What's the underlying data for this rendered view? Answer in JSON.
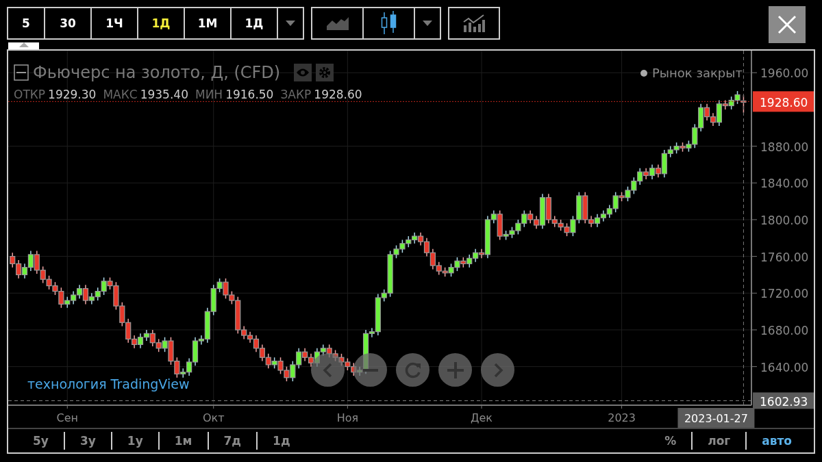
{
  "toolbar": {
    "intervals": [
      {
        "label": "5",
        "selected": false
      },
      {
        "label": "30",
        "selected": false
      },
      {
        "label": "1Ч",
        "selected": false
      },
      {
        "label": "1Д",
        "selected": true
      },
      {
        "label": "1М",
        "selected": false
      },
      {
        "label": "1Д",
        "selected": false
      }
    ],
    "chart_types": [
      {
        "kind": "line",
        "selected": false
      },
      {
        "kind": "candles",
        "selected": true
      }
    ]
  },
  "legend": {
    "title": "Фьючерс на золото, Д, (CFD)",
    "values": [
      {
        "label": "ОТКР",
        "value": "1929.30"
      },
      {
        "label": "МАКС",
        "value": "1935.40"
      },
      {
        "label": "МИН",
        "value": "1916.50"
      },
      {
        "label": "ЗАКР",
        "value": "1928.60"
      }
    ],
    "status": "Рынок закрыт"
  },
  "chart": {
    "last_price": "1928.60",
    "low_level": "1602.93",
    "crosshair_date": "2023-01-27",
    "attribution": "технология TradingView",
    "chart_data": {
      "type": "candlestick",
      "grid": true,
      "ylim": [
        1598,
        1984
      ],
      "yticks": [
        {
          "value": 1640,
          "label": "1640.00"
        },
        {
          "value": 1680,
          "label": "1680.00"
        },
        {
          "value": 1720,
          "label": "1720.00"
        },
        {
          "value": 1760,
          "label": "1760.00"
        },
        {
          "value": 1800,
          "label": "1800.00"
        },
        {
          "value": 1840,
          "label": "1840.00"
        },
        {
          "value": 1880,
          "label": "1880.00"
        },
        {
          "value": 1960,
          "label": "1960.00"
        }
      ],
      "ref_lines": [
        {
          "axis": "y",
          "value": 1928.6,
          "color": "#c0261c"
        },
        {
          "axis": "y",
          "value": 1602.93,
          "color": "#888888"
        }
      ],
      "categories": [
        null,
        null,
        null,
        null,
        null,
        null,
        null,
        null,
        null,
        "Сен",
        null,
        null,
        null,
        null,
        null,
        null,
        null,
        null,
        null,
        null,
        null,
        null,
        null,
        null,
        null,
        null,
        null,
        null,
        null,
        null,
        null,
        null,
        null,
        "Окт",
        null,
        null,
        null,
        null,
        null,
        null,
        null,
        null,
        null,
        null,
        null,
        null,
        null,
        null,
        null,
        null,
        null,
        null,
        null,
        null,
        null,
        "Ноя",
        null,
        null,
        null,
        null,
        null,
        null,
        null,
        null,
        null,
        null,
        null,
        null,
        null,
        null,
        null,
        null,
        null,
        null,
        null,
        null,
        null,
        "Дек",
        null,
        null,
        null,
        null,
        null,
        null,
        null,
        null,
        null,
        null,
        null,
        null,
        null,
        null,
        null,
        null,
        null,
        null,
        null,
        null,
        null,
        null,
        "2023",
        null,
        null,
        null,
        null,
        null,
        null,
        null,
        null,
        null,
        null,
        null,
        null,
        null,
        null,
        null,
        null,
        null,
        null,
        null,
        null
      ],
      "ohlc": [
        [
          1760,
          1764,
          1748,
          1752
        ],
        [
          1752,
          1756,
          1736,
          1740
        ],
        [
          1740,
          1752,
          1736,
          1748
        ],
        [
          1748,
          1766,
          1744,
          1762
        ],
        [
          1762,
          1766,
          1741,
          1745
        ],
        [
          1745,
          1749,
          1731,
          1735
        ],
        [
          1735,
          1739,
          1724,
          1728
        ],
        [
          1728,
          1732,
          1718,
          1722
        ],
        [
          1722,
          1726,
          1704,
          1708
        ],
        [
          1708,
          1716,
          1704,
          1712
        ],
        [
          1712,
          1722,
          1708,
          1718
        ],
        [
          1718,
          1729,
          1714,
          1725
        ],
        [
          1725,
          1729,
          1708,
          1712
        ],
        [
          1712,
          1720,
          1708,
          1716
        ],
        [
          1716,
          1726,
          1712,
          1722
        ],
        [
          1722,
          1737,
          1718,
          1733
        ],
        [
          1733,
          1737,
          1724,
          1728
        ],
        [
          1728,
          1732,
          1702,
          1706
        ],
        [
          1706,
          1710,
          1684,
          1688
        ],
        [
          1688,
          1692,
          1666,
          1670
        ],
        [
          1670,
          1674,
          1660,
          1664
        ],
        [
          1664,
          1676,
          1660,
          1672
        ],
        [
          1672,
          1680,
          1668,
          1676
        ],
        [
          1676,
          1680,
          1662,
          1666
        ],
        [
          1666,
          1670,
          1656,
          1660
        ],
        [
          1660,
          1672,
          1656,
          1668
        ],
        [
          1668,
          1672,
          1642,
          1646
        ],
        [
          1646,
          1650,
          1628,
          1632
        ],
        [
          1632,
          1638,
          1628,
          1634
        ],
        [
          1634,
          1649,
          1630,
          1645
        ],
        [
          1645,
          1672,
          1641,
          1668
        ],
        [
          1668,
          1674,
          1664,
          1670
        ],
        [
          1670,
          1704,
          1666,
          1700
        ],
        [
          1700,
          1729,
          1696,
          1725
        ],
        [
          1725,
          1736,
          1721,
          1732
        ],
        [
          1732,
          1736,
          1714,
          1718
        ],
        [
          1718,
          1722,
          1708,
          1712
        ],
        [
          1712,
          1716,
          1676,
          1680
        ],
        [
          1680,
          1684,
          1670,
          1674
        ],
        [
          1674,
          1678,
          1666,
          1670
        ],
        [
          1670,
          1674,
          1656,
          1660
        ],
        [
          1660,
          1664,
          1646,
          1650
        ],
        [
          1650,
          1654,
          1638,
          1642
        ],
        [
          1642,
          1650,
          1638,
          1646
        ],
        [
          1646,
          1650,
          1632,
          1636
        ],
        [
          1636,
          1640,
          1624,
          1628
        ],
        [
          1628,
          1646,
          1624,
          1642
        ],
        [
          1642,
          1660,
          1638,
          1656
        ],
        [
          1656,
          1660,
          1646,
          1650
        ],
        [
          1650,
          1654,
          1640,
          1644
        ],
        [
          1644,
          1660,
          1640,
          1656
        ],
        [
          1656,
          1664,
          1652,
          1660
        ],
        [
          1660,
          1664,
          1650,
          1654
        ],
        [
          1654,
          1658,
          1646,
          1650
        ],
        [
          1650,
          1654,
          1641,
          1645
        ],
        [
          1645,
          1649,
          1636,
          1640
        ],
        [
          1640,
          1644,
          1630,
          1634
        ],
        [
          1634,
          1640,
          1630,
          1636
        ],
        [
          1636,
          1680,
          1632,
          1676
        ],
        [
          1676,
          1682,
          1672,
          1678
        ],
        [
          1678,
          1719,
          1674,
          1715
        ],
        [
          1715,
          1724,
          1711,
          1720
        ],
        [
          1720,
          1766,
          1716,
          1762
        ],
        [
          1762,
          1772,
          1758,
          1768
        ],
        [
          1768,
          1778,
          1764,
          1774
        ],
        [
          1774,
          1782,
          1770,
          1778
        ],
        [
          1778,
          1786,
          1774,
          1782
        ],
        [
          1782,
          1786,
          1772,
          1776
        ],
        [
          1776,
          1780,
          1760,
          1764
        ],
        [
          1764,
          1768,
          1746,
          1750
        ],
        [
          1750,
          1754,
          1740,
          1744
        ],
        [
          1744,
          1748,
          1738,
          1742
        ],
        [
          1742,
          1752,
          1738,
          1748
        ],
        [
          1748,
          1759,
          1744,
          1755
        ],
        [
          1755,
          1759,
          1748,
          1752
        ],
        [
          1752,
          1762,
          1748,
          1758
        ],
        [
          1758,
          1768,
          1754,
          1764
        ],
        [
          1764,
          1768,
          1758,
          1762
        ],
        [
          1762,
          1804,
          1758,
          1800
        ],
        [
          1800,
          1810,
          1796,
          1806
        ],
        [
          1806,
          1810,
          1778,
          1782
        ],
        [
          1782,
          1788,
          1778,
          1784
        ],
        [
          1784,
          1792,
          1780,
          1788
        ],
        [
          1788,
          1800,
          1784,
          1796
        ],
        [
          1796,
          1810,
          1792,
          1806
        ],
        [
          1806,
          1810,
          1796,
          1800
        ],
        [
          1800,
          1804,
          1790,
          1794
        ],
        [
          1794,
          1828,
          1790,
          1824
        ],
        [
          1824,
          1828,
          1796,
          1800
        ],
        [
          1800,
          1804,
          1792,
          1796
        ],
        [
          1796,
          1800,
          1788,
          1792
        ],
        [
          1792,
          1796,
          1782,
          1786
        ],
        [
          1786,
          1804,
          1782,
          1800
        ],
        [
          1800,
          1830,
          1796,
          1826
        ],
        [
          1826,
          1830,
          1796,
          1800
        ],
        [
          1800,
          1804,
          1792,
          1796
        ],
        [
          1796,
          1806,
          1792,
          1802
        ],
        [
          1802,
          1810,
          1798,
          1806
        ],
        [
          1806,
          1816,
          1802,
          1812
        ],
        [
          1812,
          1830,
          1808,
          1826
        ],
        [
          1826,
          1830,
          1820,
          1824
        ],
        [
          1824,
          1836,
          1820,
          1832
        ],
        [
          1832,
          1846,
          1828,
          1842
        ],
        [
          1842,
          1856,
          1838,
          1852
        ],
        [
          1852,
          1856,
          1844,
          1848
        ],
        [
          1848,
          1860,
          1844,
          1856
        ],
        [
          1856,
          1860,
          1846,
          1850
        ],
        [
          1850,
          1876,
          1846,
          1872
        ],
        [
          1872,
          1880,
          1868,
          1876
        ],
        [
          1876,
          1884,
          1872,
          1880
        ],
        [
          1880,
          1884,
          1874,
          1878
        ],
        [
          1878,
          1886,
          1874,
          1882
        ],
        [
          1882,
          1904,
          1878,
          1900
        ],
        [
          1900,
          1926,
          1896,
          1922
        ],
        [
          1922,
          1926,
          1908,
          1912
        ],
        [
          1912,
          1916,
          1902,
          1906
        ],
        [
          1906,
          1930,
          1902,
          1926
        ],
        [
          1926,
          1930,
          1920,
          1924
        ],
        [
          1924,
          1934,
          1920,
          1930
        ],
        [
          1930,
          1940,
          1926,
          1936
        ],
        [
          1929.3,
          1935.4,
          1916.5,
          1928.6
        ]
      ]
    }
  },
  "ranges": [
    "5у",
    "3у",
    "1у",
    "1м",
    "7д",
    "1д"
  ],
  "scale_options": [
    {
      "label": "%",
      "selected": false
    },
    {
      "label": "лог",
      "selected": false
    },
    {
      "label": "авто",
      "selected": true
    }
  ]
}
